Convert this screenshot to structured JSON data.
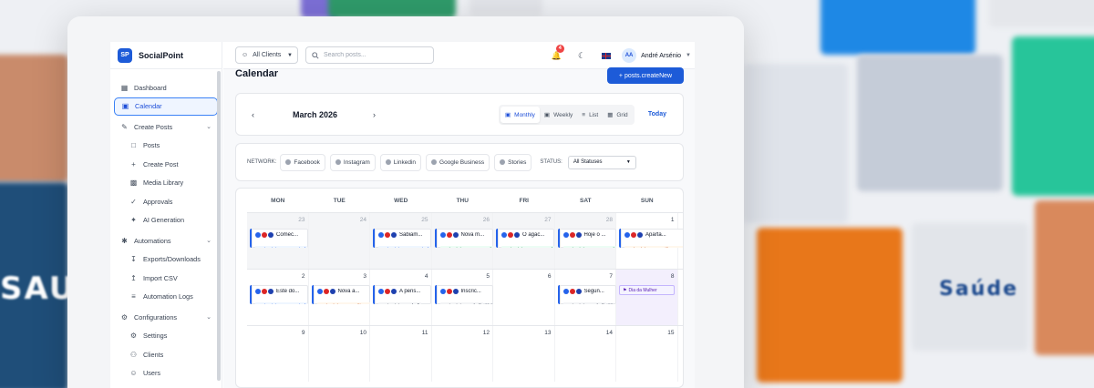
{
  "app": {
    "brand_initials": "SP",
    "brand_name": "SocialPoint"
  },
  "sidebar": {
    "items": [
      {
        "label": "Dashboard",
        "icon": "grid-icon"
      },
      {
        "label": "Calendar",
        "icon": "calendar-icon",
        "active": true
      },
      {
        "label": "Create Posts",
        "icon": "edit-icon",
        "expandable": true
      },
      {
        "label": "Posts",
        "icon": "document-icon",
        "sub": true
      },
      {
        "label": "Create Post",
        "icon": "plus-icon",
        "sub": true
      },
      {
        "label": "Media Library",
        "icon": "image-icon",
        "sub": true
      },
      {
        "label": "Approvals",
        "icon": "check-circle-icon",
        "sub": true
      },
      {
        "label": "AI Generation",
        "icon": "sparkle-icon",
        "sub": true
      },
      {
        "label": "Automations",
        "icon": "lightning-icon",
        "expandable": true
      },
      {
        "label": "Exports/Downloads",
        "icon": "download-icon",
        "sub": true
      },
      {
        "label": "Import CSV",
        "icon": "upload-icon",
        "sub": true
      },
      {
        "label": "Automation Logs",
        "icon": "list-icon",
        "sub": true
      },
      {
        "label": "Configurations",
        "icon": "gear-icon",
        "expandable": true
      },
      {
        "label": "Settings",
        "icon": "gear-icon",
        "sub": true
      },
      {
        "label": "Clients",
        "icon": "users-icon",
        "sub": true
      },
      {
        "label": "Users",
        "icon": "user-icon",
        "sub": true
      }
    ]
  },
  "topbar": {
    "client_filter": "All Clients",
    "search_placeholder": "Search posts...",
    "notification_count": "4",
    "user_initials": "AA",
    "user_name": "André Arsénio"
  },
  "page": {
    "title": "Calendar",
    "create_button": "+ posts.createNew"
  },
  "calendar_nav": {
    "month": "March 2026",
    "views": [
      "Monthly",
      "Weekly",
      "List",
      "Grid"
    ],
    "active_view": "Monthly",
    "today_label": "Today"
  },
  "filters": {
    "network_label": "NETWORK:",
    "networks": [
      "Facebook",
      "Instagram",
      "Linkedin",
      "Google Business",
      "Stories"
    ],
    "status_label": "STATUS:",
    "status_value": "All Statuses"
  },
  "weekdays": [
    "MON",
    "TUE",
    "WED",
    "THU",
    "FRI",
    "SAT",
    "SUN"
  ],
  "weeks": [
    [
      {
        "day": "23",
        "other": true,
        "events": [
          {
            "title": "Comec...",
            "status": "posts.statuses.exported",
            "kind": "exported"
          }
        ]
      },
      {
        "day": "24",
        "other": true,
        "events": []
      },
      {
        "day": "25",
        "other": true,
        "events": [
          {
            "title": "Sabiam...",
            "status": "posts.statuses.exported",
            "kind": "exported"
          }
        ]
      },
      {
        "day": "26",
        "other": true,
        "events": [
          {
            "title": "Nova m...",
            "status": "posts.statuses.approved",
            "kind": "approved"
          }
        ]
      },
      {
        "day": "27",
        "other": true,
        "events": [
          {
            "title": "O agac...",
            "status": "posts.statuses.approved",
            "kind": "approved"
          }
        ]
      },
      {
        "day": "28",
        "other": true,
        "events": [
          {
            "title": "Hoje o ...",
            "status": "posts.statuses.approved",
            "kind": "approved"
          }
        ]
      },
      {
        "day": "1",
        "other": false,
        "events": [
          {
            "title": "Aparta...",
            "status": "posts.statuses.awaiting_appr",
            "kind": "awaiting",
            "wide": true
          }
        ]
      }
    ],
    [
      {
        "day": "2",
        "events": [
          {
            "title": "Este do...",
            "status": "posts.statuses.exported",
            "kind": "exported"
          }
        ]
      },
      {
        "day": "3",
        "events": [
          {
            "title": "Nova a...",
            "status": "posts.statuses.awaiting...",
            "kind": "awaiting"
          }
        ]
      },
      {
        "day": "4",
        "events": [
          {
            "title": "A pens...",
            "status": "posts.statuses.draft",
            "kind": "draft"
          }
        ]
      },
      {
        "day": "5",
        "events": [
          {
            "title": "Inscric...",
            "status": "posts.statuses.draft",
            "kind": "draft",
            "extra": "11:1"
          }
        ]
      },
      {
        "day": "6",
        "events": []
      },
      {
        "day": "7",
        "events": [
          {
            "title": "Segun...",
            "status": "posts.statuses.draft",
            "kind": "draft",
            "extra": "06:"
          }
        ]
      },
      {
        "day": "8",
        "selected": true,
        "holiday": "Dia da Mulher",
        "events": []
      }
    ],
    [
      {
        "day": "9",
        "events": []
      },
      {
        "day": "10",
        "events": []
      },
      {
        "day": "11",
        "events": []
      },
      {
        "day": "12",
        "events": []
      },
      {
        "day": "13",
        "events": []
      },
      {
        "day": "14",
        "events": []
      },
      {
        "day": "15",
        "events": []
      }
    ]
  ],
  "backdrop": {
    "left_word": "SAUDE",
    "right_word": "Saúde"
  }
}
